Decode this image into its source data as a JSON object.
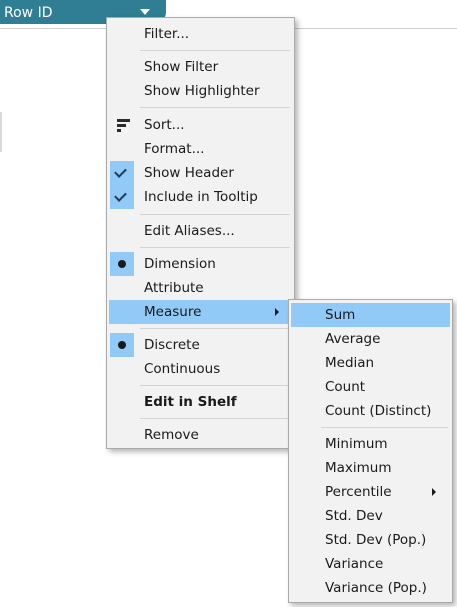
{
  "pill": {
    "label": "Row ID"
  },
  "main_menu": {
    "filter": "Filter...",
    "show_filter": "Show Filter",
    "show_highlighter": "Show Highlighter",
    "sort": "Sort...",
    "format": "Format...",
    "show_header": "Show Header",
    "include_in_tooltip": "Include in Tooltip",
    "edit_aliases": "Edit Aliases...",
    "dimension": "Dimension",
    "attribute": "Attribute",
    "measure": "Measure",
    "discrete": "Discrete",
    "continuous": "Continuous",
    "edit_in_shelf": "Edit in Shelf",
    "remove": "Remove"
  },
  "sub_menu": {
    "sum": "Sum",
    "average": "Average",
    "median": "Median",
    "count": "Count",
    "count_distinct": "Count (Distinct)",
    "minimum": "Minimum",
    "maximum": "Maximum",
    "percentile": "Percentile",
    "std_dev": "Std. Dev",
    "std_dev_pop": "Std. Dev (Pop.)",
    "variance": "Variance",
    "variance_pop": "Variance (Pop.)"
  },
  "state": {
    "checked": [
      "Show Header",
      "Include in Tooltip"
    ],
    "selected_role": "Dimension",
    "selected_type": "Discrete",
    "highlighted_main": "Measure",
    "highlighted_sub": "Sum"
  },
  "colors": {
    "pill": "#2f7e93",
    "highlight": "#91c9f7",
    "menu_bg": "#f2f2f2",
    "menu_border": "#a9a9a9"
  },
  "icons": [
    "caret-down-icon",
    "sort-icon",
    "checkmark-icon",
    "bullet-icon",
    "submenu-arrow-icon"
  ]
}
